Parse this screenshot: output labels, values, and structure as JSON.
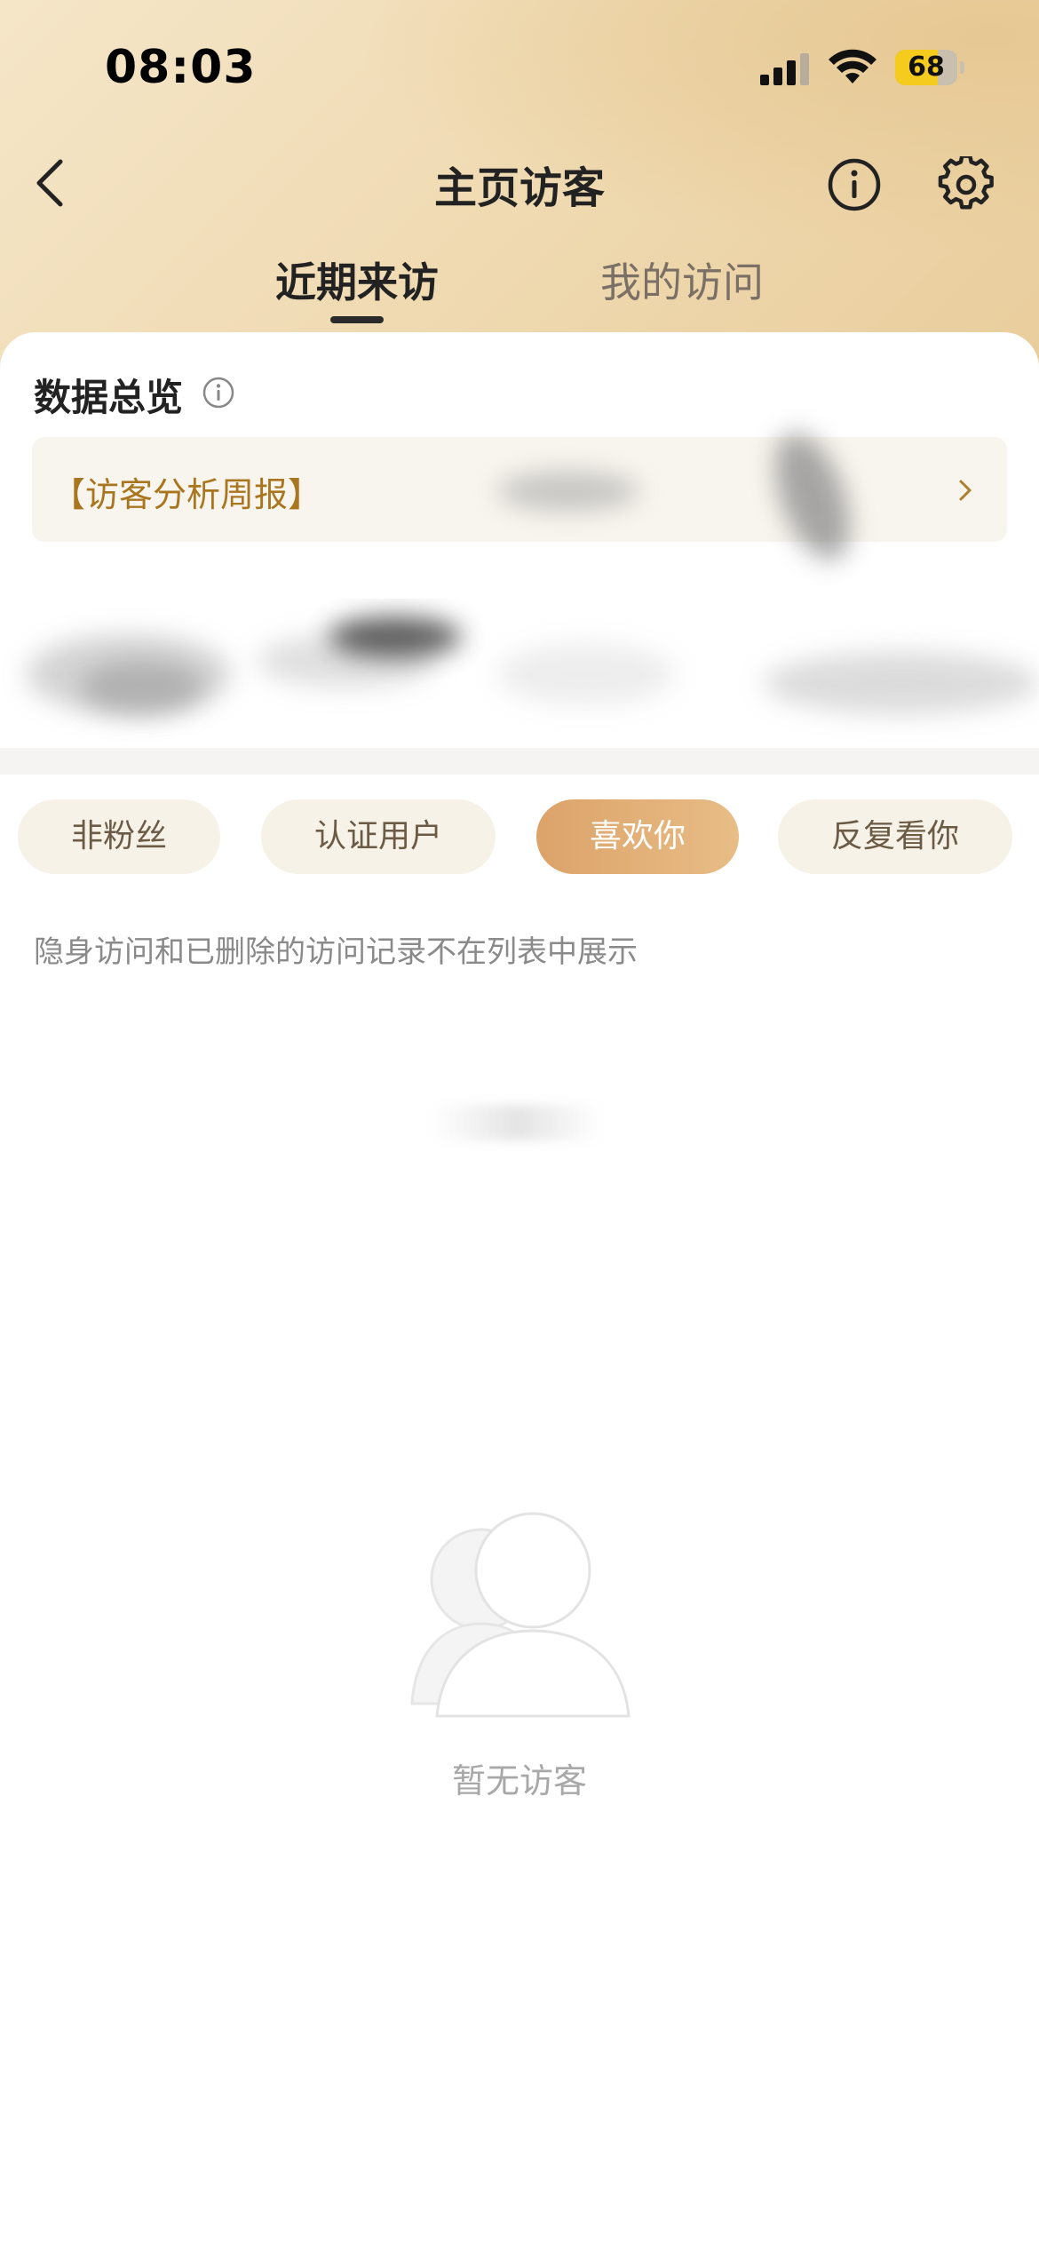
{
  "status_bar": {
    "time": "08:03",
    "battery_level": 68
  },
  "nav": {
    "title": "主页访客"
  },
  "tabs": [
    {
      "label": "近期来访",
      "active": true
    },
    {
      "label": "我的访问",
      "active": false
    }
  ],
  "overview": {
    "title": "数据总览",
    "report_label": "【访客分析周报】"
  },
  "filters": [
    {
      "label": "非粉丝",
      "active": false
    },
    {
      "label": "认证用户",
      "active": false
    },
    {
      "label": "喜欢你",
      "active": true
    },
    {
      "label": "反复看你",
      "active": false
    }
  ],
  "notice": "隐身访问和已删除的访问记录不在列表中展示",
  "empty_state": {
    "text": "暂无访客"
  },
  "colors": {
    "accent_gold": "#a9761f",
    "chip_active_start": "#dca36a",
    "chip_active_end": "#e8bd86",
    "battery_yellow": "#f5cb1e"
  },
  "icons": [
    "back-icon",
    "info-icon",
    "gear-icon",
    "chevron-right-icon",
    "signal-icon",
    "wifi-icon",
    "battery-icon",
    "empty-visitors-icon"
  ]
}
